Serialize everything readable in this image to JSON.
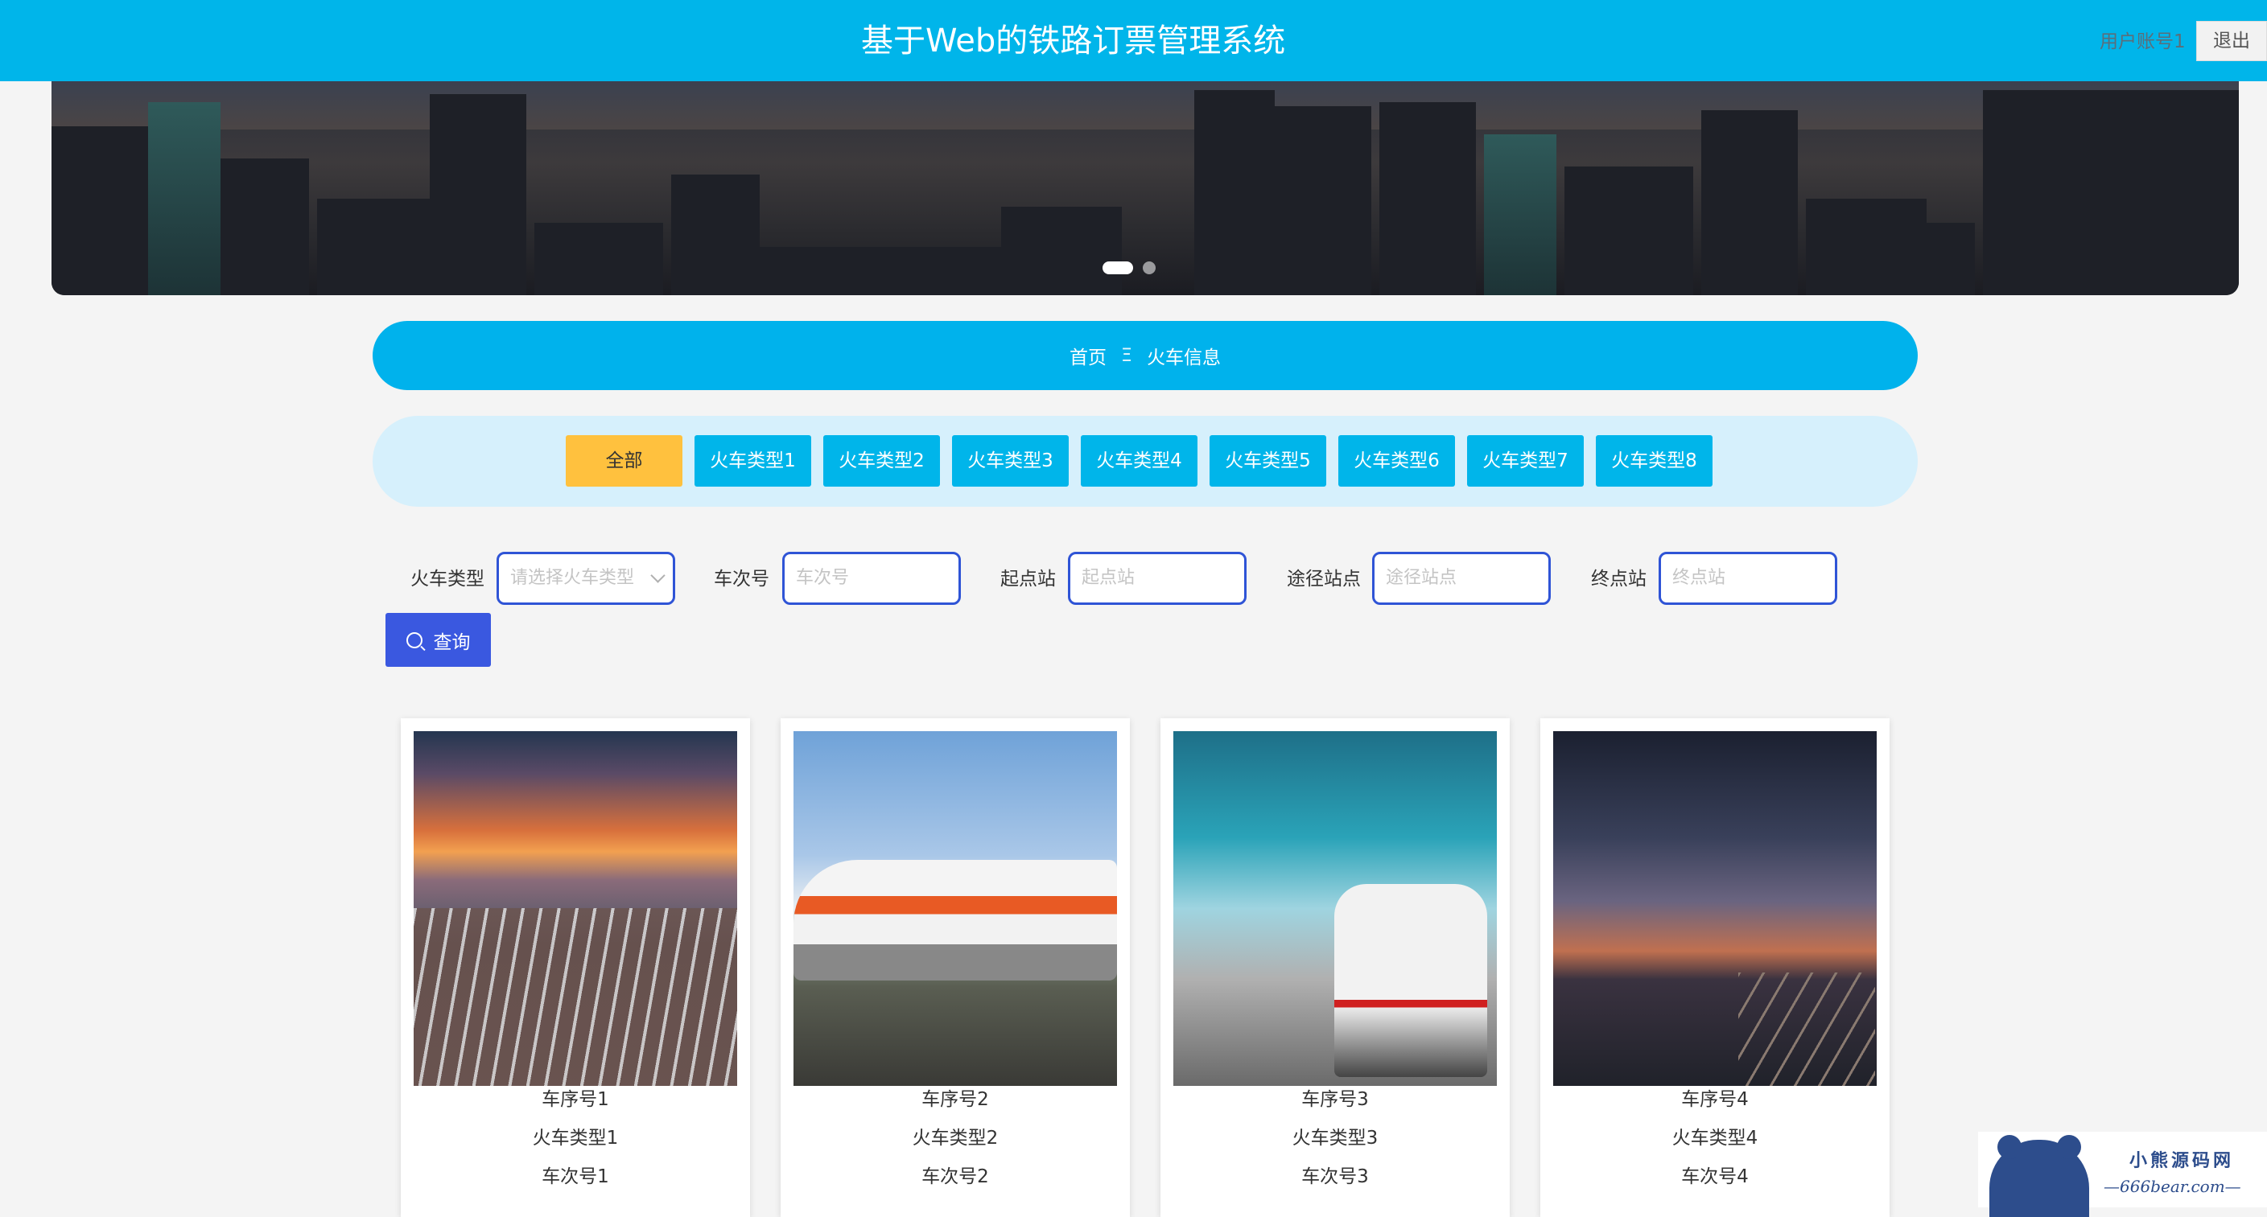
{
  "header": {
    "title": "基于Web的铁路订票管理系统",
    "user": "用户账号1",
    "logout": "退出"
  },
  "breadcrumb": {
    "home": "首页",
    "separator": "Ξ",
    "current": "火车信息"
  },
  "categories": [
    "全部",
    "火车类型1",
    "火车类型2",
    "火车类型3",
    "火车类型4",
    "火车类型5",
    "火车类型6",
    "火车类型7",
    "火车类型8"
  ],
  "search": {
    "type_label": "火车类型",
    "type_placeholder": "请选择火车类型",
    "number_label": "车次号",
    "number_placeholder": "车次号",
    "start_label": "起点站",
    "start_placeholder": "起点站",
    "via_label": "途径站点",
    "via_placeholder": "途径站点",
    "end_label": "终点站",
    "end_placeholder": "终点站",
    "button": "查询"
  },
  "trains": [
    {
      "seq": "车序号1",
      "type": "火车类型1",
      "number": "车次号1"
    },
    {
      "seq": "车序号2",
      "type": "火车类型2",
      "number": "车次号2"
    },
    {
      "seq": "车序号3",
      "type": "火车类型3",
      "number": "车次号3"
    },
    {
      "seq": "车序号4",
      "type": "火车类型4",
      "number": "车次号4"
    }
  ],
  "watermark": {
    "name": "小熊源码网",
    "url": "—666bear.com—"
  },
  "colors": {
    "primary": "#00b5ea",
    "active_tab": "#ffc13e",
    "search_button": "#3a58e0"
  }
}
